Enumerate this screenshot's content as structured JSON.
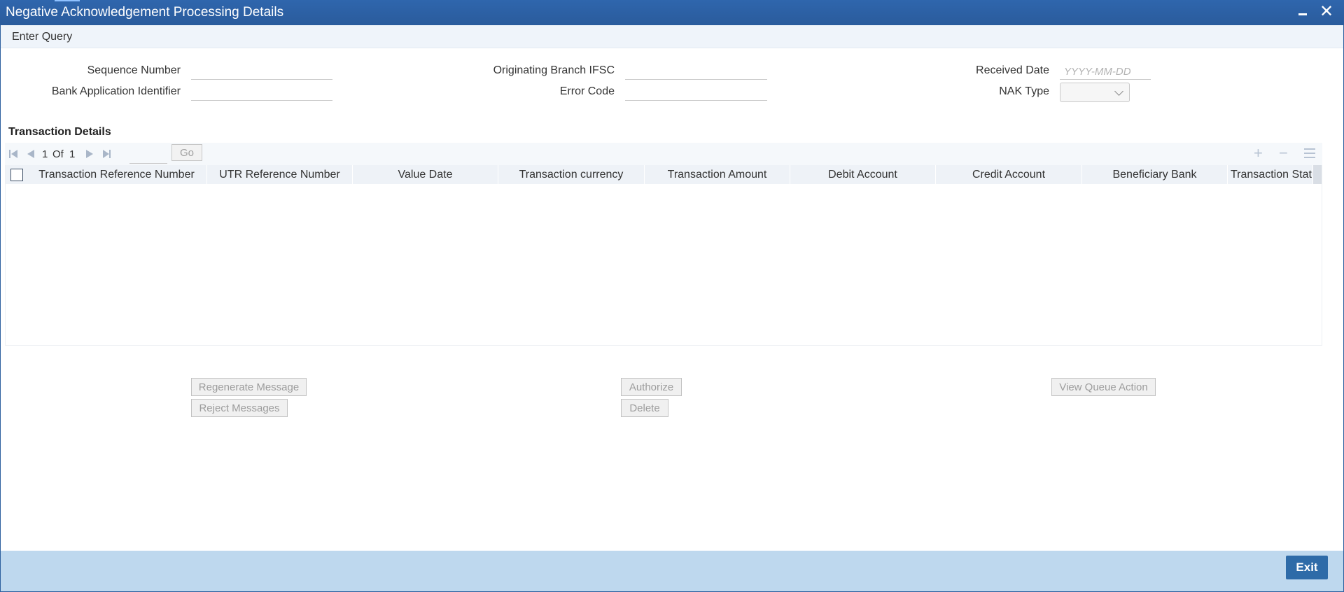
{
  "window": {
    "title": "Negative Acknowledgement Processing Details",
    "minimize_icon": "minimize-icon",
    "close_glyph": "✕"
  },
  "menu": {
    "enter_query": "Enter Query"
  },
  "form": {
    "sequence_number_label": "Sequence Number",
    "bank_app_id_label": "Bank Application Identifier",
    "originating_branch_ifsc_label": "Originating Branch IFSC",
    "error_code_label": "Error Code",
    "received_date_label": "Received Date",
    "received_date_placeholder": "YYYY-MM-DD",
    "nak_type_label": "NAK Type",
    "nak_type_value": ""
  },
  "transaction_details": {
    "title": "Transaction Details",
    "pager": {
      "current": "1",
      "of_label": "Of",
      "total": "1",
      "go_label": "Go"
    },
    "columns": [
      "Transaction Reference Number",
      "UTR Reference Number",
      "Value Date",
      "Transaction currency",
      "Transaction Amount",
      "Debit Account",
      "Credit Account",
      "Beneficiary Bank",
      "Transaction Status"
    ],
    "rows": []
  },
  "actions": {
    "regenerate_message": "Regenerate Message",
    "reject_messages": "Reject Messages",
    "authorize": "Authorize",
    "delete": "Delete",
    "view_queue_action": "View Queue Action"
  },
  "footer": {
    "exit": "Exit"
  },
  "colors": {
    "titlebar": "#2a5b9c",
    "footer": "#bed8ee",
    "exit_button": "#2e6ba8"
  }
}
